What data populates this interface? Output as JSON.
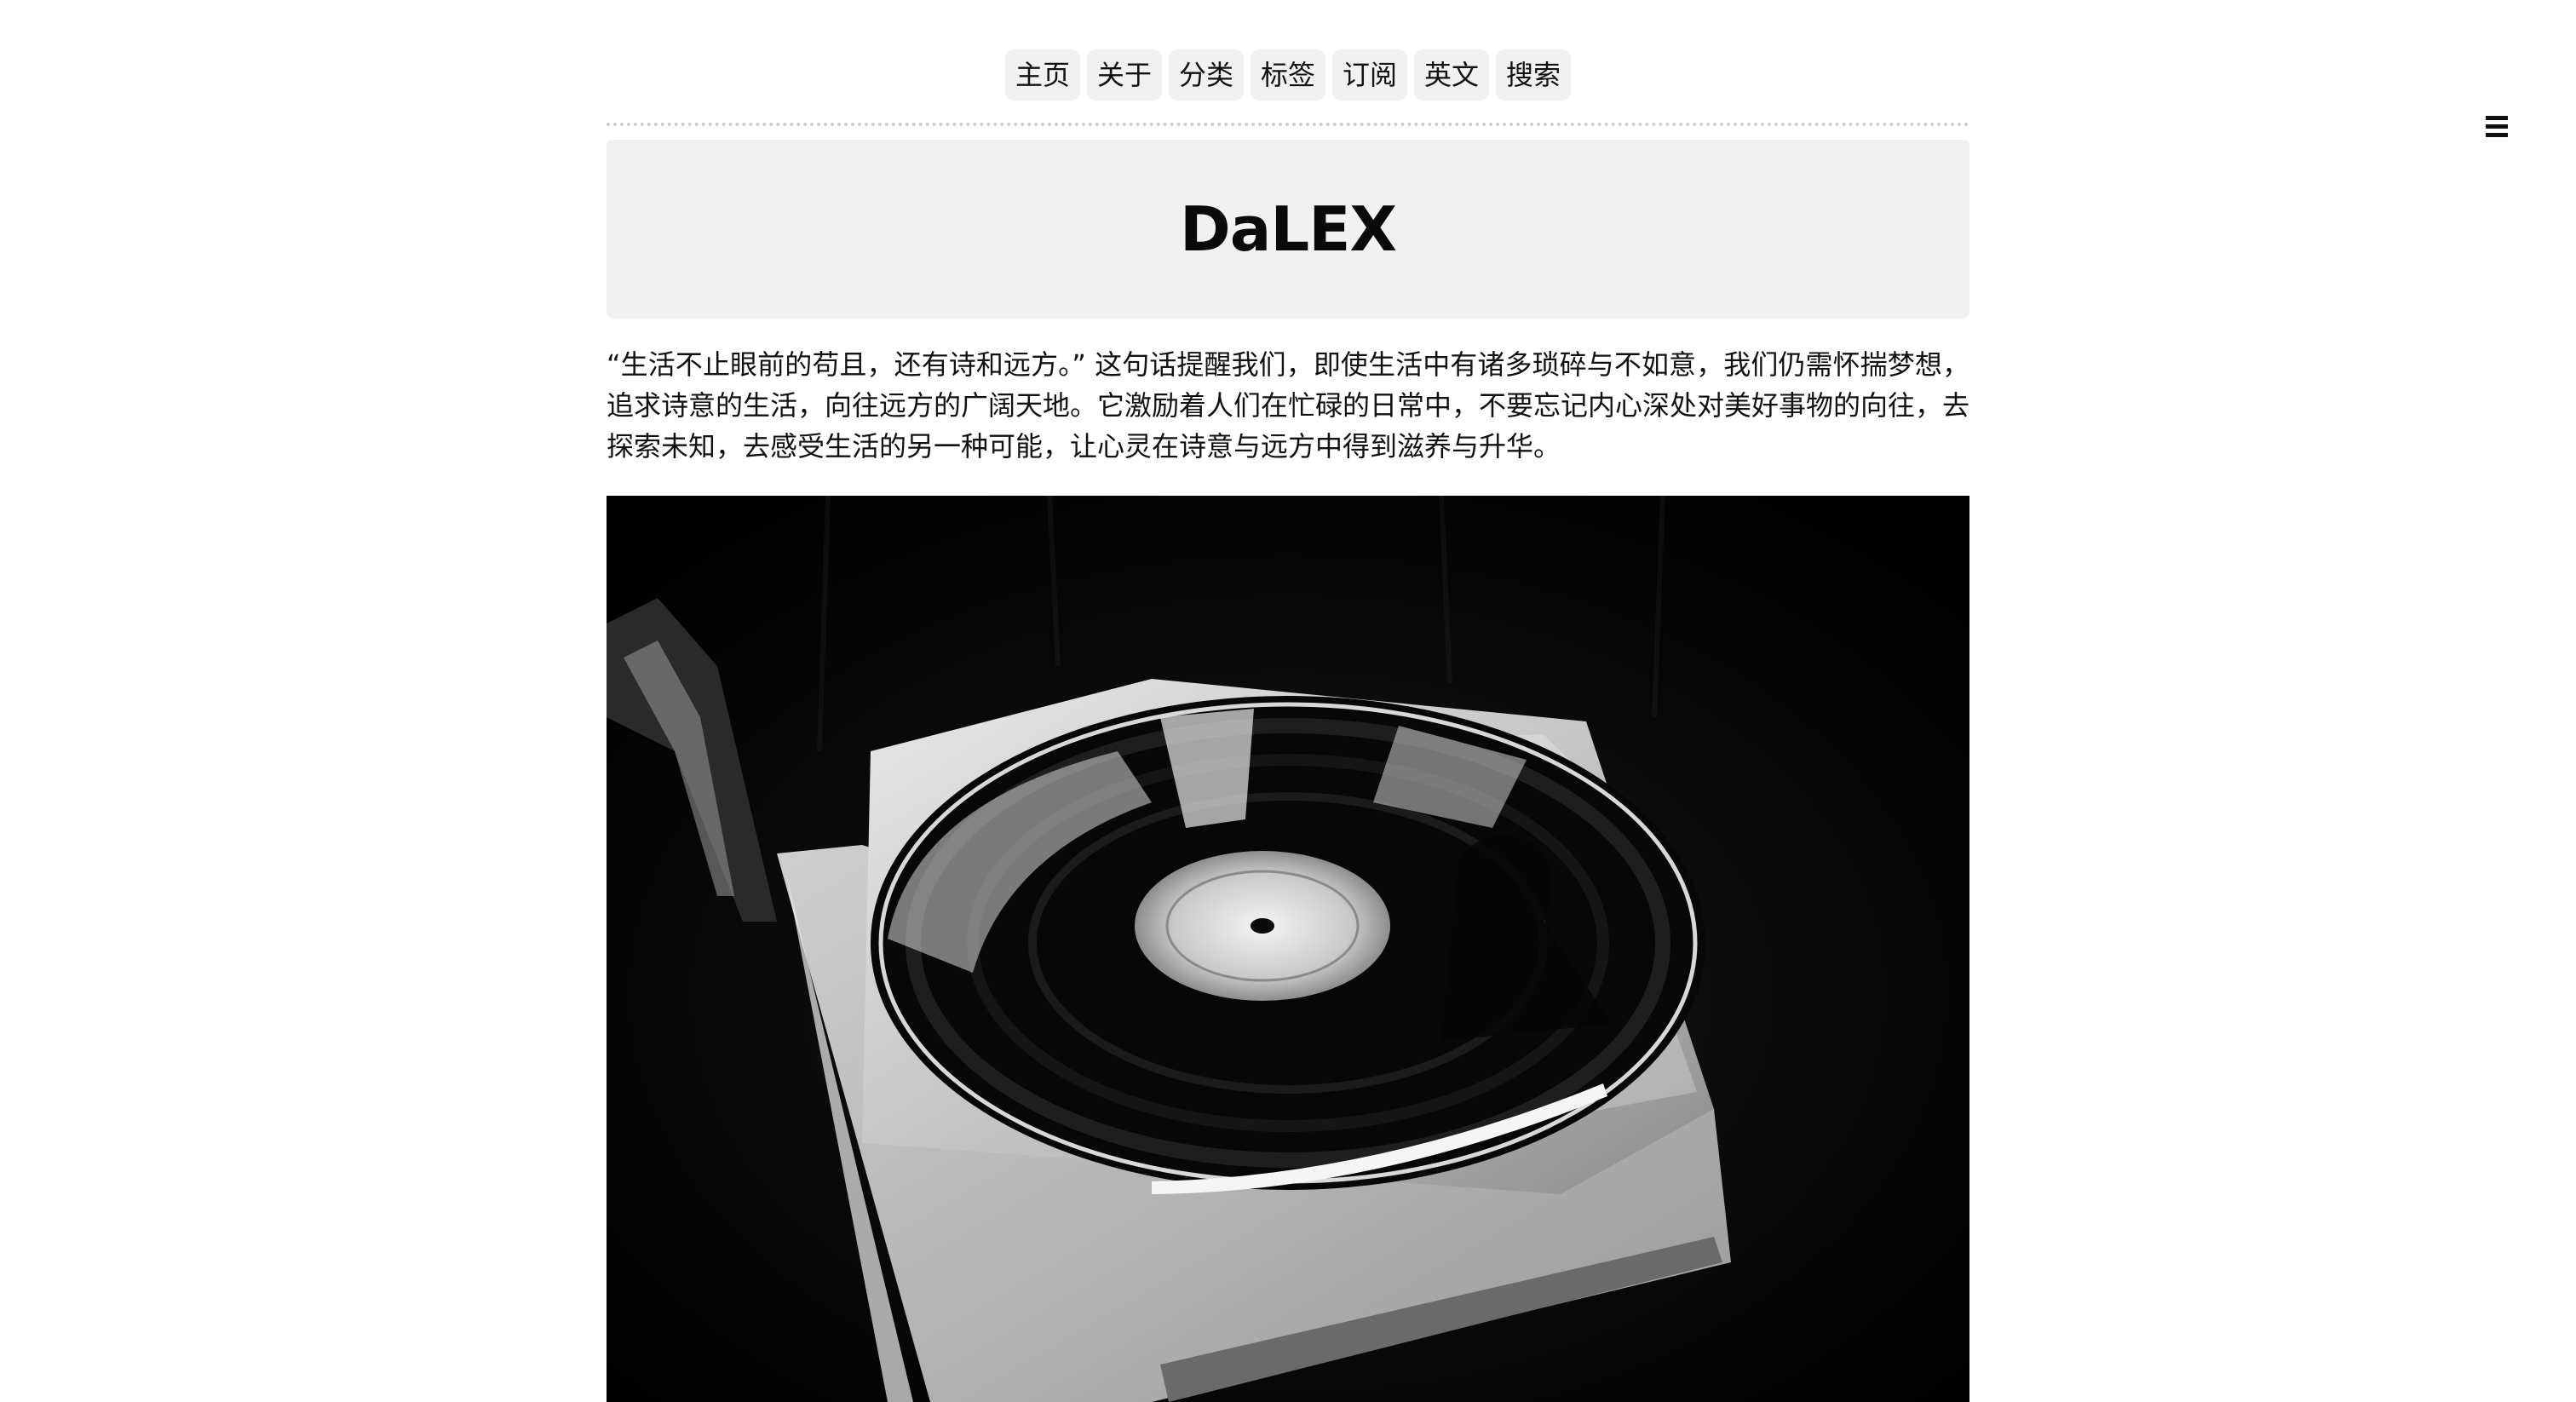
{
  "nav": {
    "items": [
      {
        "label": "主页"
      },
      {
        "label": "关于"
      },
      {
        "label": "分类"
      },
      {
        "label": "标签"
      },
      {
        "label": "订阅"
      },
      {
        "label": "英文"
      },
      {
        "label": "搜索"
      }
    ]
  },
  "menu": {
    "icon": "hamburger-menu-icon"
  },
  "site": {
    "title": "DaLEX"
  },
  "intro": {
    "text": "“生活不止眼前的苟且，还有诗和远方。” 这句话提醒我们，即使生活中有诸多琐碎与不如意，我们仍需怀揣梦想，追求诗意的生活，向往远方的广阔天地。它激励着人们在忙碌的日常中，不要忘记内心深处对美好事物的向往，去探索未知，去感受生活的另一种可能，让心灵在诗意与远方中得到滋养与升华。"
  },
  "hero_image": {
    "subject": "vinyl-record-photo"
  },
  "colors": {
    "nav_bg": "#f1f1f1",
    "hero_bg": "#f1f1f1",
    "text": "#111111",
    "divider": "#cfcfcf"
  }
}
